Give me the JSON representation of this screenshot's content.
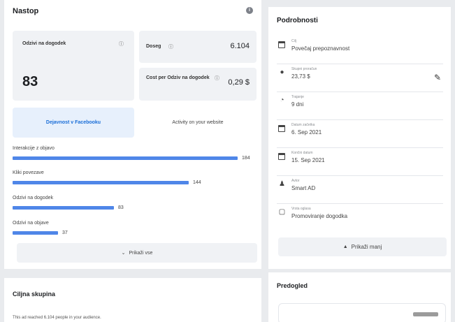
{
  "performance": {
    "title": "Nastop",
    "responses": {
      "label": "Odzivi na dogodek",
      "value": "83"
    },
    "reach": {
      "label": "Doseg",
      "value": "6.104"
    },
    "cost": {
      "label": "Cost per Odziv na dogodek",
      "value": "0,29 $"
    },
    "tabs": {
      "facebook": "Dejavnost v Facebooku",
      "website": "Activity on your website"
    },
    "metrics": [
      {
        "label": "Interakcije z objavo",
        "value": 184,
        "value_text": "184"
      },
      {
        "label": "Kliki povezave",
        "value": 144,
        "value_text": "144"
      },
      {
        "label": "Odzivi na dogodek",
        "value": 83,
        "value_text": "83"
      },
      {
        "label": "Odzivi na objave",
        "value": 37,
        "value_text": "37"
      }
    ],
    "metric_max": 184,
    "show_more": "Prikaži vse"
  },
  "details": {
    "title": "Podrobnosti",
    "items": [
      {
        "label": "Cilj",
        "value": "Povečaj prepoznavnost",
        "icon": "calendar-icon"
      },
      {
        "label": "Skupni proračun",
        "value": "23,73 $",
        "icon": "budget-icon"
      },
      {
        "label": "Trajanje",
        "value": "9 dni",
        "icon": "clock-icon"
      },
      {
        "label": "Datum začetka",
        "value": "6. Sep 2021",
        "icon": "calendar-icon"
      },
      {
        "label": "Končni datum",
        "value": "15. Sep 2021",
        "icon": "calendar-icon"
      },
      {
        "label": "Avtor",
        "value": "Smart AD",
        "icon": "person-icon"
      },
      {
        "label": "Vrsta oglasa",
        "value": "Promoviranje dogodka",
        "icon": "ad-type-icon"
      }
    ],
    "show_less": "Prikaži manj"
  },
  "audience": {
    "title": "Ciljna skupina",
    "text": "This ad reached 6.104 people in your audience."
  },
  "preview": {
    "title": "Predogled"
  },
  "colors": {
    "accent": "#4f86e8",
    "tab_bg": "#e7f0fc",
    "tab_text": "#1a6ed8",
    "card_gray": "#f0f2f5"
  }
}
